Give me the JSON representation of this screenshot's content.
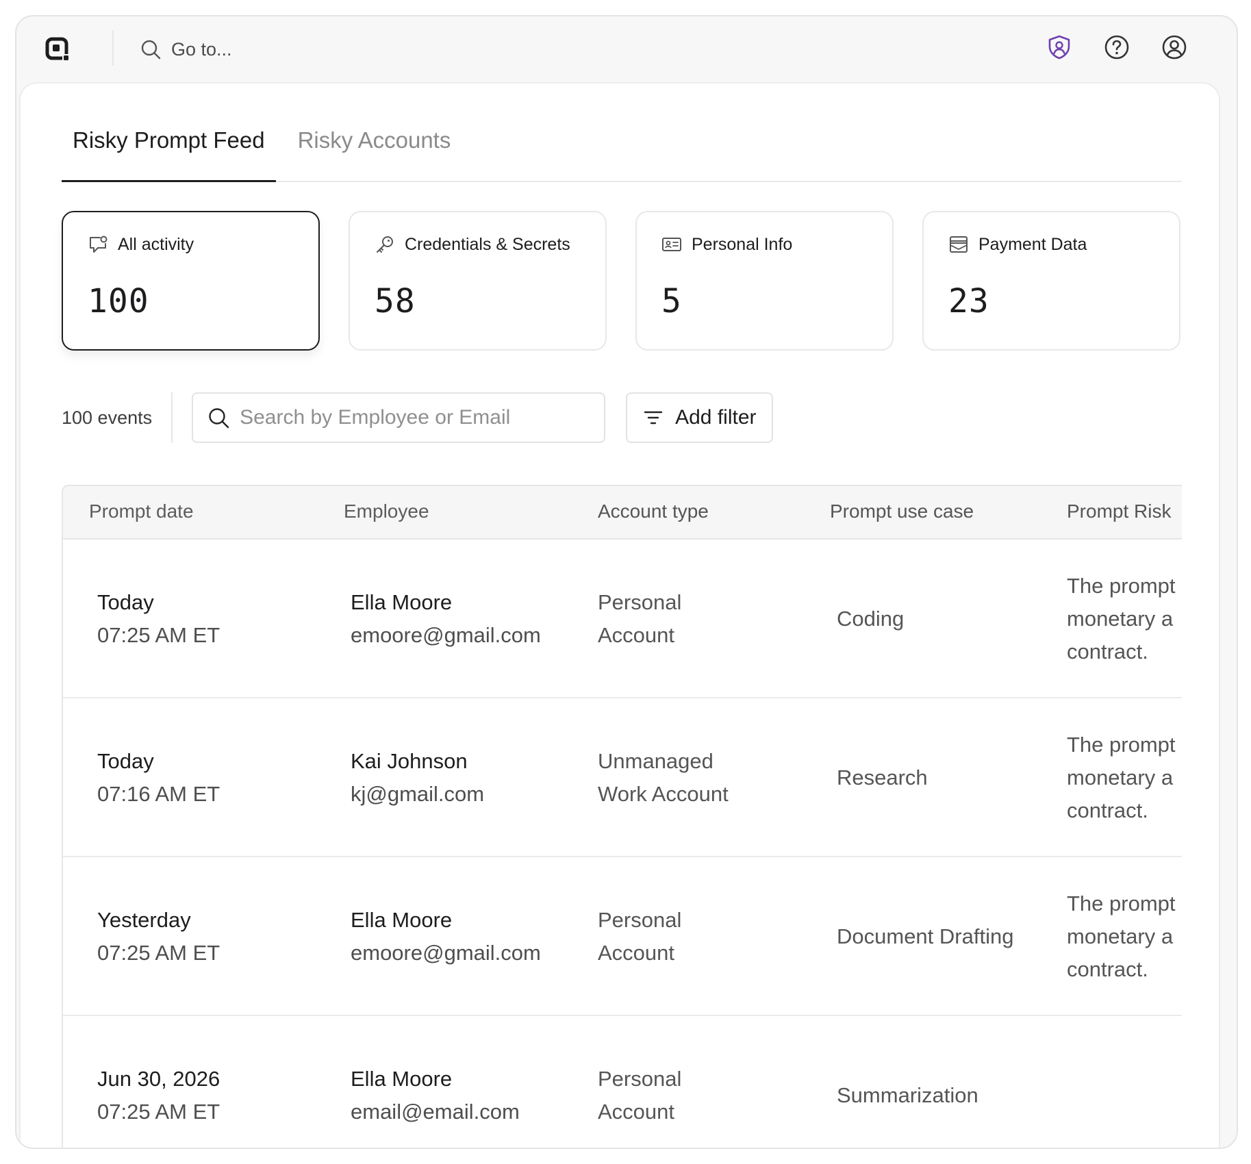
{
  "topbar": {
    "goto_placeholder": "Go to...",
    "icons": [
      "app-logo-icon",
      "search-icon",
      "shield-user-icon",
      "help-icon",
      "account-icon"
    ],
    "accent": "#6e3fb0"
  },
  "tabs": [
    {
      "label": "Risky Prompt Feed",
      "active": true
    },
    {
      "label": "Risky Accounts",
      "active": false
    }
  ],
  "cards": [
    {
      "icon": "chat-alert-icon",
      "label": "All activity",
      "value": "100",
      "active": true
    },
    {
      "icon": "key-icon",
      "label": "Credentials & Secrets",
      "value": "58",
      "active": false
    },
    {
      "icon": "id-card-icon",
      "label": "Personal Info",
      "value": "5",
      "active": false
    },
    {
      "icon": "payment-card-icon",
      "label": "Payment Data",
      "value": "23",
      "active": false
    }
  ],
  "filters": {
    "event_count": "100 events",
    "search_placeholder": "Search by Employee or Email",
    "add_filter_label": "Add filter"
  },
  "table": {
    "columns": [
      "Prompt date",
      "Employee",
      "Account type",
      "Prompt use case",
      "Prompt Risk"
    ],
    "rows": [
      {
        "day": "Today",
        "time": "07:25 AM ET",
        "name": "Ella Moore",
        "email": "emoore@gmail.com",
        "account_line1": "Personal",
        "account_line2": "Account",
        "use_case": "Coding",
        "risk_line1": "The prompt",
        "risk_line2": "monetary a",
        "risk_line3": "contract."
      },
      {
        "day": "Today",
        "time": "07:16 AM ET",
        "name": "Kai Johnson",
        "email": "kj@gmail.com",
        "account_line1": "Unmanaged",
        "account_line2": "Work Account",
        "use_case": "Research",
        "risk_line1": "The prompt",
        "risk_line2": "monetary a",
        "risk_line3": "contract."
      },
      {
        "day": "Yesterday",
        "time": "07:25 AM ET",
        "name": "Ella Moore",
        "email": "emoore@gmail.com",
        "account_line1": "Personal",
        "account_line2": "Account",
        "use_case": "Document Drafting",
        "risk_line1": "The prompt",
        "risk_line2": "monetary a",
        "risk_line3": "contract."
      },
      {
        "day": "Jun 30, 2026",
        "time": "07:25 AM ET",
        "name": "Ella Moore",
        "email": "email@email.com",
        "account_line1": "Personal",
        "account_line2": "Account",
        "use_case": "Summarization",
        "risk_line1": "",
        "risk_line2": "",
        "risk_line3": ""
      }
    ]
  }
}
